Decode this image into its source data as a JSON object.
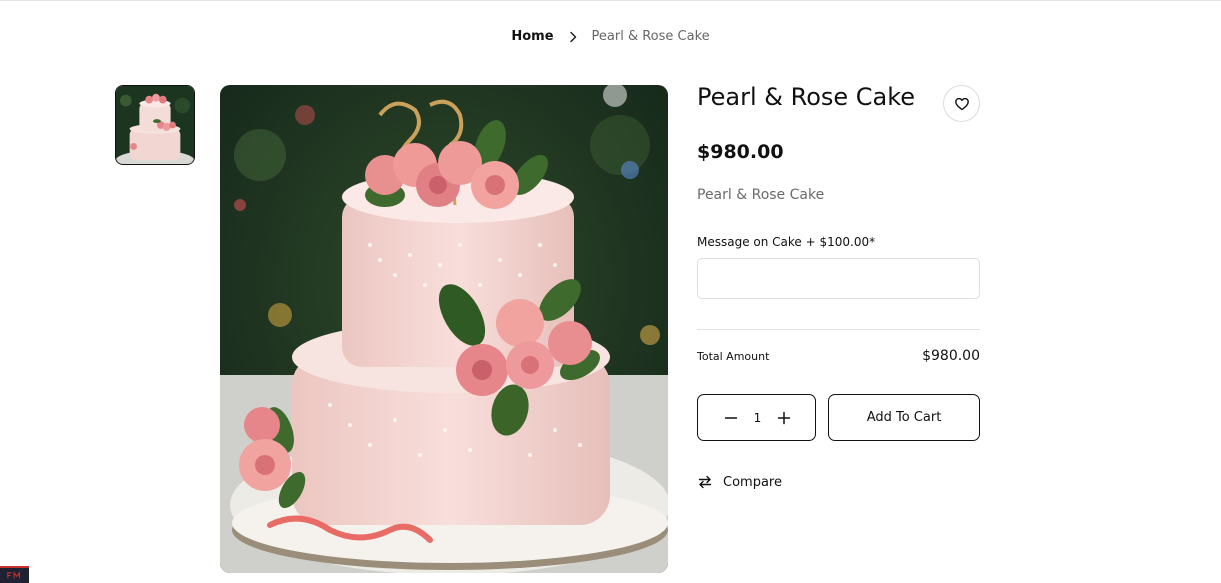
{
  "breadcrumb": {
    "home": "Home",
    "current": "Pearl & Rose Cake"
  },
  "product": {
    "title": "Pearl & Rose Cake",
    "price": "$980.00",
    "subtitle": "Pearl & Rose Cake",
    "message_label": "Message on Cake + $100.00*",
    "message_value": "",
    "total_label": "Total Amount",
    "total_value": "$980.00",
    "quantity": "1",
    "add_to_cart": "Add To Cart",
    "compare": "Compare"
  },
  "icons": {
    "breadcrumb_sep": "chevron-right-icon",
    "wishlist": "heart-icon",
    "minus": "minus-icon",
    "plus": "plus-icon",
    "compare": "compare-arrows-icon"
  },
  "colors": {
    "background": "#ffffff",
    "text": "#111111",
    "muted": "#666666",
    "border": "#dedede",
    "corner_badge": "#1e2233",
    "corner_badge_accent": "#c9302c"
  }
}
